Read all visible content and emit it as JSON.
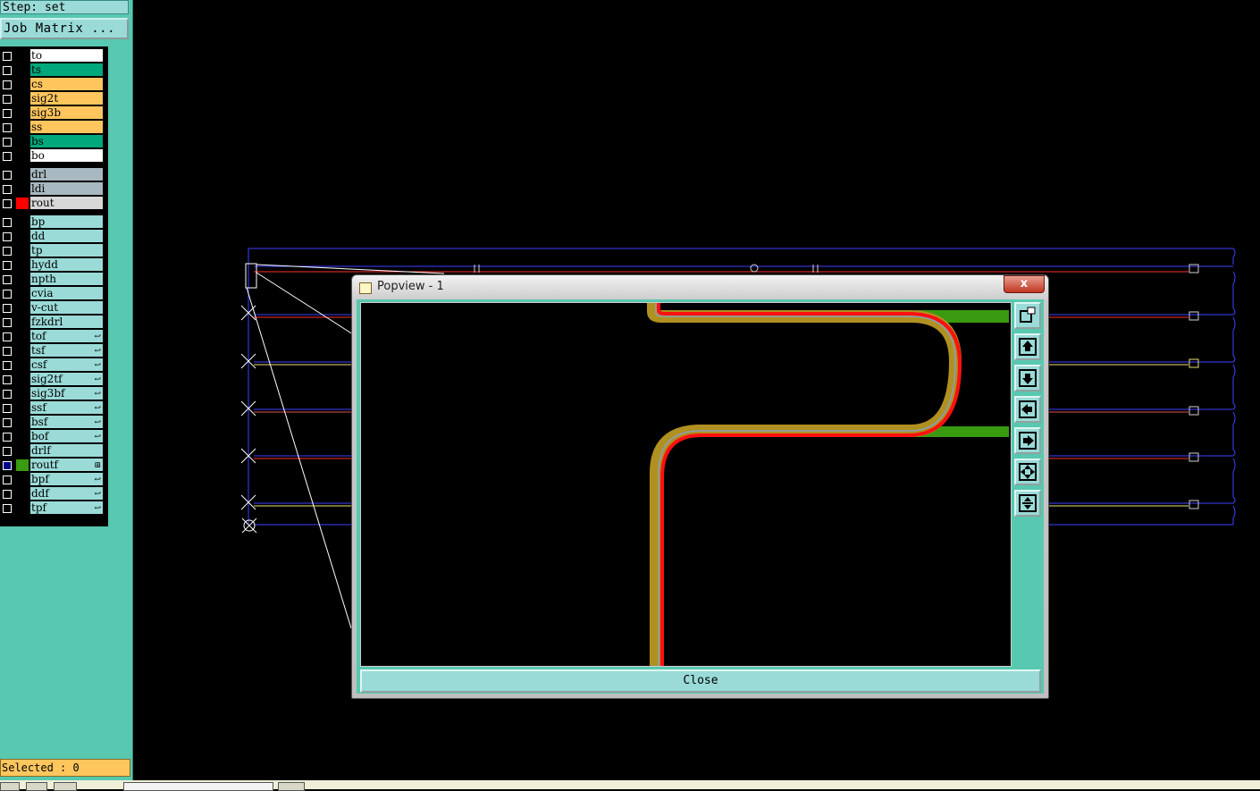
{
  "step_label": "Step: set",
  "job_matrix_label": "Job Matrix ...",
  "layers": [
    {
      "name": "to",
      "bg": "#ffffff",
      "swatch": "",
      "checked": false,
      "arrow": ""
    },
    {
      "name": "ts",
      "bg": "#00a87c",
      "swatch": "",
      "checked": false,
      "arrow": ""
    },
    {
      "name": "cs",
      "bg": "#ffc65e",
      "swatch": "",
      "checked": false,
      "arrow": ""
    },
    {
      "name": "sig2t",
      "bg": "#ffc65e",
      "swatch": "",
      "checked": false,
      "arrow": ""
    },
    {
      "name": "sig3b",
      "bg": "#ffc65e",
      "swatch": "",
      "checked": false,
      "arrow": ""
    },
    {
      "name": "ss",
      "bg": "#ffc65e",
      "swatch": "",
      "checked": false,
      "arrow": ""
    },
    {
      "name": "bs",
      "bg": "#00a87c",
      "swatch": "",
      "checked": false,
      "arrow": ""
    },
    {
      "name": "bo",
      "bg": "#ffffff",
      "swatch": "",
      "checked": false,
      "arrow": ""
    },
    {
      "name": "drl",
      "bg": "#a8b8c0",
      "swatch": "",
      "checked": false,
      "arrow": ""
    },
    {
      "name": "ldi",
      "bg": "#a8b8c0",
      "swatch": "",
      "checked": false,
      "arrow": ""
    },
    {
      "name": "rout",
      "bg": "#d8d8d8",
      "swatch": "#ff0000",
      "checked": false,
      "arrow": ""
    },
    {
      "name": "bp",
      "bg": "#9adbd8",
      "swatch": "",
      "checked": false,
      "arrow": ""
    },
    {
      "name": "dd",
      "bg": "#9adbd8",
      "swatch": "",
      "checked": false,
      "arrow": ""
    },
    {
      "name": "tp",
      "bg": "#9adbd8",
      "swatch": "",
      "checked": false,
      "arrow": ""
    },
    {
      "name": "hydd",
      "bg": "#9adbd8",
      "swatch": "",
      "checked": false,
      "arrow": ""
    },
    {
      "name": "npth",
      "bg": "#9adbd8",
      "swatch": "",
      "checked": false,
      "arrow": ""
    },
    {
      "name": "cvia",
      "bg": "#9adbd8",
      "swatch": "",
      "checked": false,
      "arrow": ""
    },
    {
      "name": "v-cut",
      "bg": "#9adbd8",
      "swatch": "",
      "checked": false,
      "arrow": ""
    },
    {
      "name": "fzkdrl",
      "bg": "#9adbd8",
      "swatch": "",
      "checked": false,
      "arrow": ""
    },
    {
      "name": "tof",
      "bg": "#9adbd8",
      "swatch": "",
      "checked": false,
      "arrow": "↩"
    },
    {
      "name": "tsf",
      "bg": "#9adbd8",
      "swatch": "",
      "checked": false,
      "arrow": "↩"
    },
    {
      "name": "csf",
      "bg": "#9adbd8",
      "swatch": "",
      "checked": false,
      "arrow": "↩"
    },
    {
      "name": "sig2tf",
      "bg": "#9adbd8",
      "swatch": "",
      "checked": false,
      "arrow": "↩"
    },
    {
      "name": "sig3bf",
      "bg": "#9adbd8",
      "swatch": "",
      "checked": false,
      "arrow": "↩"
    },
    {
      "name": "ssf",
      "bg": "#9adbd8",
      "swatch": "",
      "checked": false,
      "arrow": "↩"
    },
    {
      "name": "bsf",
      "bg": "#9adbd8",
      "swatch": "",
      "checked": false,
      "arrow": "↩"
    },
    {
      "name": "bof",
      "bg": "#9adbd8",
      "swatch": "",
      "checked": false,
      "arrow": "↩"
    },
    {
      "name": "drlf",
      "bg": "#9adbd8",
      "swatch": "",
      "checked": false,
      "arrow": ""
    },
    {
      "name": "routf",
      "bg": "#9adbd8",
      "swatch": "#3a9a10",
      "checked": true,
      "arrow": "⊞"
    },
    {
      "name": "bpf",
      "bg": "#9adbd8",
      "swatch": "",
      "checked": false,
      "arrow": "↩"
    },
    {
      "name": "ddf",
      "bg": "#9adbd8",
      "swatch": "",
      "checked": false,
      "arrow": "↩"
    },
    {
      "name": "tpf",
      "bg": "#9adbd8",
      "swatch": "",
      "checked": false,
      "arrow": "↩"
    }
  ],
  "selected_label": "Selected : 0",
  "popview": {
    "title": "Popview - 1",
    "close_x": "x",
    "close_button": "Close",
    "tools": [
      "window-zoom-icon",
      "pan-up-icon",
      "pan-down-icon",
      "pan-left-icon",
      "pan-right-icon",
      "zoom-fit-icon",
      "zoom-home-icon"
    ]
  },
  "colors": {
    "panel_bg": "#58c8b0",
    "button_bg": "#9adbd8",
    "selected_bg": "#ffc65e",
    "route_red": "#ff0000",
    "route_green": "#3a9a10",
    "route_olive": "#b09020",
    "outline_blue": "#4040ff"
  }
}
